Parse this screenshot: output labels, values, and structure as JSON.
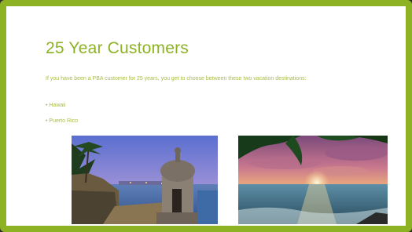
{
  "slide": {
    "title": "25 Year Customers",
    "body": "If you have been a PBA customer for 25 years, you get to choose between these two vacation destinations:",
    "bullets": [
      "• Hawaii",
      "• Puerto Rico"
    ]
  },
  "colors": {
    "frame": "#8db324",
    "title": "#8db324",
    "text": "#a8bd45",
    "slide_background": "#ffffff"
  },
  "images": [
    {
      "name": "puerto-rico-sentry-box-photo"
    },
    {
      "name": "tropical-beach-sunset-photo"
    }
  ]
}
